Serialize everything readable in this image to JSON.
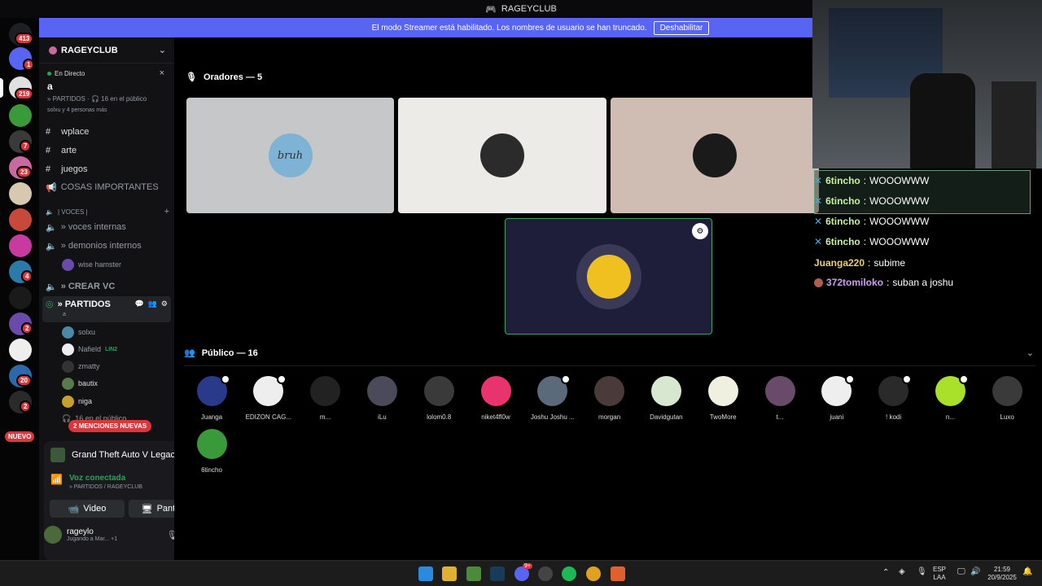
{
  "window": {
    "title": "RAGEYCLUB"
  },
  "banner": {
    "text": "El modo Streamer está habilitado. Los nombres de usuario se han truncado.",
    "button": "Deshabilitar"
  },
  "servers": {
    "badges": [
      "413",
      "1",
      "219",
      "7",
      "23",
      "4",
      "2",
      "20",
      "2"
    ],
    "nuevo": "NUEVO"
  },
  "sidebar": {
    "server_name": "RAGEYCLUB",
    "live_label": "En Directo",
    "stage_name": "a",
    "stage_info": "» PARTIDOS · 🎧 16 en el público",
    "stage_people": "solxu y 4 personas más",
    "channels": [
      {
        "name": "wplace"
      },
      {
        "name": "arte"
      },
      {
        "name": "juegos"
      },
      {
        "name": "COSAS IMPORTANTES"
      }
    ],
    "voice_category": "| VOCES |",
    "voice_channels": [
      "» voces internas",
      "» demonios internos"
    ],
    "wise_user": "wise hamster",
    "crear_vc": "» CREAR VC",
    "partidos": "» PARTIDOS",
    "partidos_sub": "a",
    "partidos_users": [
      {
        "name": "solxu",
        "color": "#4a8aa8"
      },
      {
        "name": "Nafield",
        "tag": "LIN2",
        "color": "#eeeeee"
      },
      {
        "name": "zmatty",
        "color": "#333333"
      },
      {
        "name": "bautix",
        "color": "#5a7a4a"
      },
      {
        "name": "niga",
        "color": "#c9a02a"
      }
    ],
    "public_line": "16 en el público",
    "mentions": "2 MENCIONES NUEVAS"
  },
  "voice_panel": {
    "game": "Grand Theft Auto V Legacy",
    "status": "Voz conectada",
    "location": "» PARTIDOS / RAGEYCLUB",
    "video_label": "Video",
    "screen_label": "Pantalla"
  },
  "user_panel": {
    "username": "rageylo",
    "activity": "Jugando a Mar...",
    "extra": "+1"
  },
  "stage": {
    "speakers_title": "Oradores — 5",
    "speakers": [
      {
        "id": "s1",
        "bg": "#c5c7c9",
        "avatar": "#7fb3d5",
        "label": "bruh"
      },
      {
        "id": "s2",
        "bg": "#ecebe8",
        "avatar": "#2b2b2b",
        "label": ""
      },
      {
        "id": "s3",
        "bg": "#cfbcb3",
        "avatar": "#1a1a1a",
        "label": ""
      },
      {
        "id": "s4",
        "bg": "#1e1d3a",
        "avatar": "#f0c020",
        "label": ""
      }
    ],
    "audience_title": "Público — 16",
    "audience": [
      {
        "name": "Juanga",
        "color": "#2a3a8a"
      },
      {
        "name": "EDIZON CAG...",
        "color": "#eeeeee"
      },
      {
        "name": "m...",
        "color": "#222222"
      },
      {
        "name": "iLu",
        "color": "#4a4a5a"
      },
      {
        "name": "lolom0.8",
        "color": "#3a3a3a"
      },
      {
        "name": "niket4fl0w",
        "color": "#e8336e"
      },
      {
        "name": "Joshu Joshu ...",
        "color": "#5a6a7a"
      },
      {
        "name": "morgan",
        "color": "#4a3a3a"
      },
      {
        "name": "Davidgutan",
        "color": "#d8e8d0"
      },
      {
        "name": "TwoMore",
        "color": "#f0f0e0"
      },
      {
        "name": "t...",
        "color": "#6a4a6a"
      },
      {
        "name": "juani",
        "color": "#eeeeee"
      },
      {
        "name": "! kodi",
        "color": "#2a2a2a"
      },
      {
        "name": "n...",
        "color": "#a8e02a"
      },
      {
        "name": "Luxo",
        "color": "#3a3a3a"
      },
      {
        "name": "6tincho",
        "color": "#3a9a3a"
      }
    ]
  },
  "chat": [
    {
      "user": "6tincho",
      "text": "WOOOWWW"
    },
    {
      "user": "6tincho",
      "text": "WOOOWWW"
    },
    {
      "user": "6tincho",
      "text": "WOOOWWW"
    },
    {
      "user": "6tincho",
      "text": "WOOOWWW"
    },
    {
      "user": "Juanga220",
      "text": "subime"
    },
    {
      "user": "372tomiloko",
      "text": "suban a joshu"
    }
  ],
  "taskbar": {
    "lang_top": "ESP",
    "lang_bottom": "LAA",
    "time": "21:59",
    "date": "20/9/2025",
    "discord_badge": "9+"
  }
}
